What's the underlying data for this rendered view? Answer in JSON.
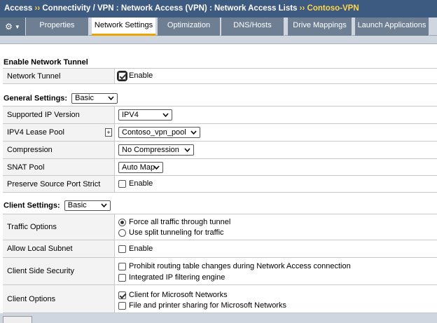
{
  "breadcrumb": {
    "items": [
      "Access",
      "Connectivity / VPN : Network Access (VPN) : Network Access Lists"
    ],
    "current": "Contoso-VPN",
    "separator": "››"
  },
  "tabs": [
    {
      "label": "Properties",
      "active": false
    },
    {
      "label": "Network Settings",
      "active": true
    },
    {
      "label": "Optimization",
      "active": false
    },
    {
      "label": "DNS/Hosts",
      "active": false
    },
    {
      "label": "Drive Mappings",
      "active": false
    },
    {
      "label": "Launch Applications",
      "active": false
    }
  ],
  "tunnel_section": {
    "title": "Enable Network Tunnel",
    "network_tunnel": {
      "label": "Network Tunnel",
      "checkbox_label": "Enable",
      "checked": true
    }
  },
  "general": {
    "title": "General Settings:",
    "mode": "Basic",
    "supported_ip_version": {
      "label": "Supported IP Version",
      "value": "IPV4"
    },
    "ipv4_lease_pool": {
      "label": "IPV4 Lease Pool",
      "value": "Contoso_vpn_pool",
      "add_symbol": "+"
    },
    "compression": {
      "label": "Compression",
      "value": "No Compression"
    },
    "snat_pool": {
      "label": "SNAT Pool",
      "value": "Auto Map"
    },
    "preserve_source_port": {
      "label": "Preserve Source Port Strict",
      "checkbox_label": "Enable",
      "checked": false
    }
  },
  "client": {
    "title": "Client Settings:",
    "mode": "Basic",
    "traffic_options": {
      "label": "Traffic Options",
      "options": [
        "Force all traffic through tunnel",
        "Use split tunneling for traffic"
      ],
      "selected_index": 0
    },
    "allow_local_subnet": {
      "label": "Allow Local Subnet",
      "checkbox_label": "Enable",
      "checked": false
    },
    "client_side_security": {
      "label": "Client Side Security",
      "options": [
        {
          "label": "Prohibit routing table changes during Network Access connection",
          "checked": false
        },
        {
          "label": "Integrated IP filtering engine",
          "checked": false
        }
      ]
    },
    "client_options": {
      "label": "Client Options",
      "options": [
        {
          "label": "Client for Microsoft Networks",
          "checked": true
        },
        {
          "label": "File and printer sharing for Microsoft Networks",
          "checked": false
        }
      ]
    }
  },
  "colors": {
    "breadcrumb_bg": "#3d5a80",
    "breadcrumb_accent": "#ffd54a",
    "tab_bg": "#6e7f93",
    "tab_active_underline": "#e8a500"
  },
  "icons": {
    "menu": "gear-icon",
    "dropdown": "chevron-down-icon"
  }
}
